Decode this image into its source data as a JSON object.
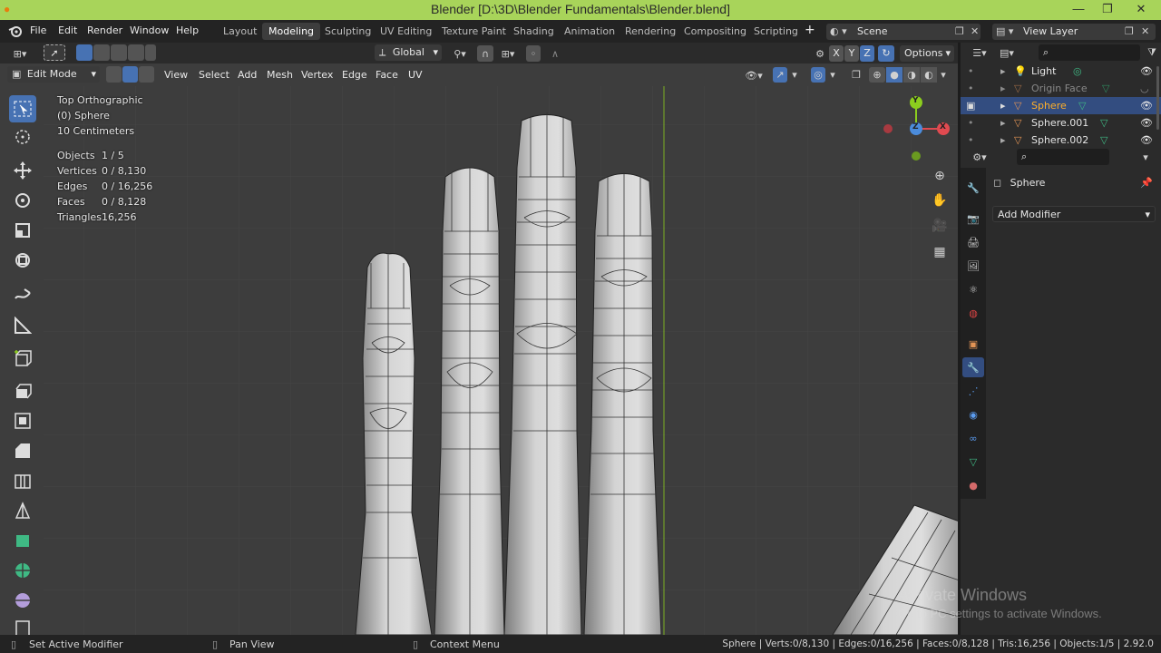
{
  "window": {
    "title": "Blender [D:\\3D\\Blender Fundamentals\\Blender.blend]",
    "min": "—",
    "max": "❐",
    "close": "✕"
  },
  "menu": {
    "file": "File",
    "edit": "Edit",
    "render": "Render",
    "window": "Window",
    "help": "Help"
  },
  "workspaces": [
    "Layout",
    "Modeling",
    "Sculpting",
    "UV Editing",
    "Texture Paint",
    "Shading",
    "Animation",
    "Rendering",
    "Compositing",
    "Scripting"
  ],
  "scene": {
    "label": "Scene",
    "view_layer": "View Layer"
  },
  "header": {
    "transform_orientation": "Global",
    "options": "Options",
    "axes": [
      "X",
      "Y",
      "Z"
    ],
    "mode": "Edit Mode",
    "menus": [
      "View",
      "Select",
      "Add",
      "Mesh",
      "Vertex",
      "Edge",
      "Face",
      "UV"
    ]
  },
  "overlay": {
    "view_name": "Top Orthographic",
    "object": "(0) Sphere",
    "scale": "10 Centimeters",
    "stats": [
      {
        "label": "Objects",
        "value": "1 / 5"
      },
      {
        "label": "Vertices",
        "value": "0 / 8,130"
      },
      {
        "label": "Edges",
        "value": "0 / 16,256"
      },
      {
        "label": "Faces",
        "value": "0 / 8,128"
      },
      {
        "label": "Triangles",
        "value": "16,256"
      }
    ]
  },
  "gizmo": {
    "y": "Y",
    "z": "Z",
    "x": "X"
  },
  "outliner": {
    "items": [
      {
        "name": "Light",
        "selected": false,
        "dim": false
      },
      {
        "name": "Origin Face",
        "selected": false,
        "dim": true
      },
      {
        "name": "Sphere",
        "selected": true,
        "dim": false
      },
      {
        "name": "Sphere.001",
        "selected": false,
        "dim": false
      },
      {
        "name": "Sphere.002",
        "selected": false,
        "dim": false
      }
    ]
  },
  "properties": {
    "object_name": "Sphere",
    "add_modifier": "Add Modifier"
  },
  "watermark": {
    "line1": "Activate Windows",
    "line2": "Go to PC settings to activate Windows."
  },
  "status": {
    "left": "Set Active Modifier",
    "middle": "Pan View",
    "right": "Context Menu",
    "info": "Sphere | Verts:0/8,130 | Edges:0/16,256 | Faces:0/8,128 | Tris:16,256 | Objects:1/5 | 2.92.0"
  },
  "colors": {
    "accent": "#4772b3",
    "title_bar": "#a8d45a",
    "x_axis": "#e04a50",
    "y_axis": "#8ccd1e",
    "z_axis": "#4b8cdc"
  }
}
